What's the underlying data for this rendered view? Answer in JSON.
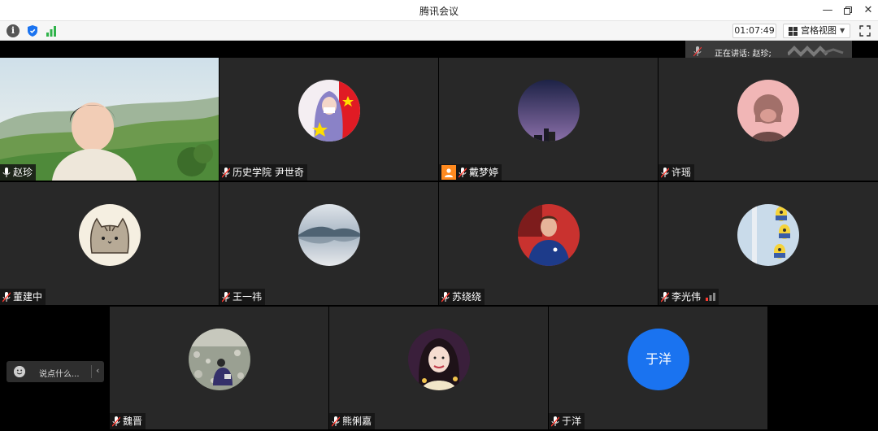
{
  "window": {
    "title": "腾讯会议"
  },
  "toolbar": {
    "timer": "01:07:49",
    "view_mode": "宫格视图"
  },
  "speaking": {
    "label": "正在讲话: 赵珍;"
  },
  "chat": {
    "placeholder": "说点什么..."
  },
  "participants": [
    {
      "name": "赵珍",
      "avatar": "video-landscape"
    },
    {
      "name": "历史学院 尹世奇",
      "avatar": "hooded-figure-flag"
    },
    {
      "name": "戴梦婷",
      "avatar": "night-sky",
      "badge": "user-badge"
    },
    {
      "name": "许瑶",
      "avatar": "cartoon-girl-pink"
    },
    {
      "name": "董建中",
      "avatar": "pusheen-cat"
    },
    {
      "name": "王一祎",
      "avatar": "misty-lake"
    },
    {
      "name": "苏绕绕",
      "avatar": "football-player"
    },
    {
      "name": "李光伟",
      "avatar": "minions",
      "signal": true
    },
    {
      "name": "魏晋",
      "avatar": "person-on-rocks"
    },
    {
      "name": "熊俐嘉",
      "avatar": "illustrated-woman"
    },
    {
      "name": "于洋",
      "avatar": "initials",
      "avatar_text": "于洋"
    }
  ],
  "colors": {
    "tile_bg": "#282828",
    "accent_blue": "#1a73f0",
    "badge_orange": "#ff8a1f",
    "signal_green": "#2fb34a"
  }
}
